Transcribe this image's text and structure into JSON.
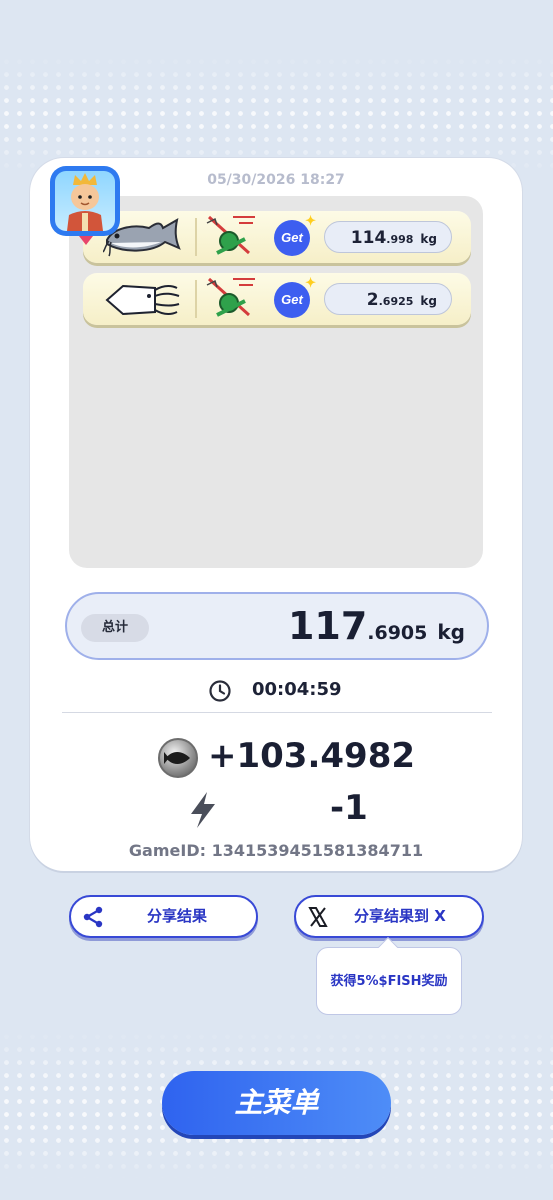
{
  "header": {
    "datetime": "05/30/2026 18:27"
  },
  "catches": [
    {
      "fish": "catfish",
      "weight_int": "114",
      "weight_dec": ".998",
      "unit": "kg",
      "badge": "Get"
    },
    {
      "fish": "squid",
      "weight_int": "2",
      "weight_dec": ".6925",
      "unit": "kg",
      "badge": "Get"
    }
  ],
  "summary": {
    "total_label": "总计",
    "total_int": "117",
    "total_dec": ".6905",
    "total_unit": "kg",
    "duration": "00:04:59",
    "reward": "+103.4982",
    "energy": "-1",
    "game_id": "GameID: 1341539451581384711"
  },
  "actions": {
    "share_label": "分享结果",
    "share_x_label": "分享结果到 X",
    "tooltip": "获得5%$FISH奖励",
    "main_menu": "主菜单"
  },
  "icons": {
    "avatar": "avatar",
    "rod": "fishing-rod-icon",
    "clock": "clock-icon",
    "coin": "fish-coin-icon",
    "energy": "lightning-icon",
    "share": "share-icon",
    "x": "x-logo-icon"
  },
  "colors": {
    "accent": "#3849d6",
    "primary_button": "#3a73f2",
    "background": "#dde6f2"
  }
}
